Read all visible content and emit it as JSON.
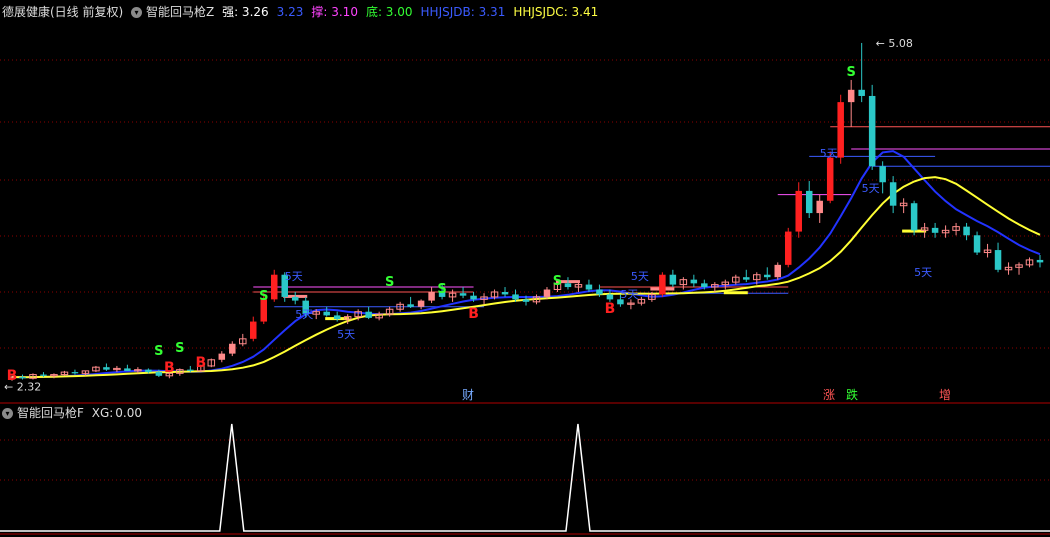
{
  "header": {
    "stock_label": "德展健康(日线 前复权)",
    "indicator_name": "智能回马枪Z",
    "readouts": [
      {
        "label": "强:",
        "value": "3.26",
        "color": "#ffffff"
      },
      {
        "label": "",
        "value": "3.23",
        "color": "#3b5bff"
      },
      {
        "label": "撑:",
        "value": "3.10",
        "color": "#ff44ff"
      },
      {
        "label": "底:",
        "value": "3.00",
        "color": "#33ff33"
      },
      {
        "label": "HHJSJDB:",
        "value": "3.31",
        "color": "#3b5bff"
      },
      {
        "label": "HHJSJDC:",
        "value": "3.41",
        "color": "#ffff44"
      }
    ]
  },
  "sub_header": {
    "indicator_name": "智能回马枪F",
    "readout_label": "XG:",
    "readout_value": "0.00"
  },
  "price_labels": {
    "high": "5.08",
    "low": "2.32"
  },
  "event_markers": [
    {
      "text": "财",
      "color": "#77aaff"
    },
    {
      "text": "涨",
      "color": "#ff5555"
    },
    {
      "text": "跌",
      "color": "#33ff33"
    },
    {
      "text": "增",
      "color": "#ff5555"
    }
  ],
  "colors": {
    "background": "#000000",
    "up_dark": "#ff2020",
    "up_light": "#ff8a8a",
    "down": "#2bc8c8",
    "ma_blue": "#2233ff",
    "ma_yellow": "#ffff33",
    "grid": "#8b0000",
    "signal_B": "#ff2020",
    "signal_S": "#33ff33",
    "five_day_text": "#3b5bff",
    "xg_line": "#ffffff"
  },
  "signals": {
    "buy_text": "B",
    "sell_text": "S",
    "five_day_text": "5天"
  },
  "candles": [
    [
      2.36,
      2.38,
      2.34,
      2.37
    ],
    [
      2.37,
      2.39,
      2.35,
      2.36
    ],
    [
      2.36,
      2.4,
      2.35,
      2.39
    ],
    [
      2.39,
      2.41,
      2.37,
      2.38
    ],
    [
      2.38,
      2.4,
      2.36,
      2.39
    ],
    [
      2.39,
      2.42,
      2.38,
      2.41
    ],
    [
      2.41,
      2.43,
      2.39,
      2.4
    ],
    [
      2.4,
      2.42,
      2.38,
      2.42
    ],
    [
      2.42,
      2.46,
      2.41,
      2.45
    ],
    [
      2.45,
      2.48,
      2.42,
      2.43
    ],
    [
      2.43,
      2.46,
      2.41,
      2.44
    ],
    [
      2.44,
      2.47,
      2.42,
      2.42
    ],
    [
      2.42,
      2.45,
      2.4,
      2.43
    ],
    [
      2.43,
      2.44,
      2.4,
      2.41
    ],
    [
      2.41,
      2.43,
      2.37,
      2.38
    ],
    [
      2.38,
      2.42,
      2.36,
      2.4
    ],
    [
      2.4,
      2.44,
      2.38,
      2.43
    ],
    [
      2.43,
      2.46,
      2.41,
      2.42
    ],
    [
      2.42,
      2.47,
      2.41,
      2.46
    ],
    [
      2.46,
      2.52,
      2.45,
      2.51
    ],
    [
      2.51,
      2.58,
      2.49,
      2.56
    ],
    [
      2.56,
      2.66,
      2.54,
      2.64
    ],
    [
      2.64,
      2.72,
      2.62,
      2.68
    ],
    [
      2.68,
      2.86,
      2.66,
      2.82
    ],
    [
      2.82,
      3.05,
      2.8,
      3.0
    ],
    [
      3.0,
      3.24,
      2.98,
      3.2
    ],
    [
      3.2,
      3.22,
      2.98,
      3.02
    ],
    [
      3.02,
      3.06,
      2.96,
      2.99
    ],
    [
      2.99,
      3.02,
      2.85,
      2.88
    ],
    [
      2.88,
      2.92,
      2.84,
      2.9
    ],
    [
      2.9,
      2.94,
      2.86,
      2.87
    ],
    [
      2.87,
      2.9,
      2.82,
      2.84
    ],
    [
      2.84,
      2.88,
      2.8,
      2.86
    ],
    [
      2.86,
      2.92,
      2.83,
      2.9
    ],
    [
      2.9,
      2.94,
      2.84,
      2.85
    ],
    [
      2.85,
      2.9,
      2.83,
      2.88
    ],
    [
      2.88,
      2.94,
      2.86,
      2.92
    ],
    [
      2.92,
      2.98,
      2.9,
      2.96
    ],
    [
      2.96,
      3.02,
      2.93,
      2.94
    ],
    [
      2.94,
      3.0,
      2.92,
      2.99
    ],
    [
      2.99,
      3.1,
      2.97,
      3.06
    ],
    [
      3.06,
      3.12,
      3.0,
      3.02
    ],
    [
      3.02,
      3.08,
      2.98,
      3.05
    ],
    [
      3.05,
      3.1,
      3.01,
      3.03
    ],
    [
      3.03,
      3.06,
      2.98,
      3.0
    ],
    [
      3.0,
      3.05,
      2.96,
      3.02
    ],
    [
      3.02,
      3.08,
      3.0,
      3.06
    ],
    [
      3.06,
      3.1,
      3.02,
      3.04
    ],
    [
      3.04,
      3.08,
      2.98,
      3.0
    ],
    [
      3.0,
      3.03,
      2.95,
      2.98
    ],
    [
      2.98,
      3.04,
      2.96,
      3.02
    ],
    [
      3.02,
      3.1,
      3.0,
      3.08
    ],
    [
      3.08,
      3.16,
      3.06,
      3.13
    ],
    [
      3.13,
      3.18,
      3.08,
      3.1
    ],
    [
      3.1,
      3.15,
      3.06,
      3.12
    ],
    [
      3.12,
      3.16,
      3.06,
      3.08
    ],
    [
      3.08,
      3.12,
      3.02,
      3.04
    ],
    [
      3.04,
      3.08,
      2.98,
      3.0
    ],
    [
      3.0,
      3.04,
      2.94,
      2.96
    ],
    [
      2.96,
      3.0,
      2.92,
      2.97
    ],
    [
      2.97,
      3.02,
      2.95,
      3.0
    ],
    [
      3.0,
      3.06,
      2.98,
      3.04
    ],
    [
      3.04,
      3.22,
      3.02,
      3.2
    ],
    [
      3.2,
      3.24,
      3.1,
      3.12
    ],
    [
      3.12,
      3.18,
      3.08,
      3.16
    ],
    [
      3.16,
      3.2,
      3.1,
      3.13
    ],
    [
      3.13,
      3.16,
      3.08,
      3.1
    ],
    [
      3.1,
      3.14,
      3.06,
      3.12
    ],
    [
      3.12,
      3.16,
      3.08,
      3.14
    ],
    [
      3.14,
      3.2,
      3.12,
      3.18
    ],
    [
      3.18,
      3.24,
      3.14,
      3.16
    ],
    [
      3.16,
      3.22,
      3.12,
      3.2
    ],
    [
      3.2,
      3.26,
      3.16,
      3.18
    ],
    [
      3.18,
      3.3,
      3.16,
      3.28
    ],
    [
      3.28,
      3.58,
      3.26,
      3.55
    ],
    [
      3.55,
      3.95,
      3.5,
      3.88
    ],
    [
      3.88,
      3.96,
      3.66,
      3.7
    ],
    [
      3.7,
      3.85,
      3.62,
      3.8
    ],
    [
      3.8,
      4.2,
      3.78,
      4.15
    ],
    [
      4.15,
      4.66,
      4.1,
      4.6
    ],
    [
      4.6,
      4.78,
      4.4,
      4.7
    ],
    [
      4.7,
      5.08,
      4.6,
      4.65
    ],
    [
      4.65,
      4.74,
      4.05,
      4.08
    ],
    [
      4.08,
      4.12,
      3.86,
      3.95
    ],
    [
      3.95,
      4.0,
      3.7,
      3.76
    ],
    [
      3.76,
      3.82,
      3.7,
      3.78
    ],
    [
      3.78,
      3.8,
      3.52,
      3.56
    ],
    [
      3.56,
      3.62,
      3.5,
      3.58
    ],
    [
      3.58,
      3.62,
      3.5,
      3.54
    ],
    [
      3.54,
      3.6,
      3.5,
      3.56
    ],
    [
      3.56,
      3.62,
      3.52,
      3.59
    ],
    [
      3.59,
      3.62,
      3.48,
      3.52
    ],
    [
      3.52,
      3.55,
      3.36,
      3.38
    ],
    [
      3.38,
      3.45,
      3.34,
      3.4
    ],
    [
      3.4,
      3.46,
      3.22,
      3.24
    ],
    [
      3.24,
      3.3,
      3.2,
      3.26
    ],
    [
      3.26,
      3.3,
      3.2,
      3.28
    ],
    [
      3.28,
      3.34,
      3.26,
      3.32
    ],
    [
      3.32,
      3.36,
      3.26,
      3.3
    ]
  ],
  "xg_signals": [
    20,
    53
  ]
}
